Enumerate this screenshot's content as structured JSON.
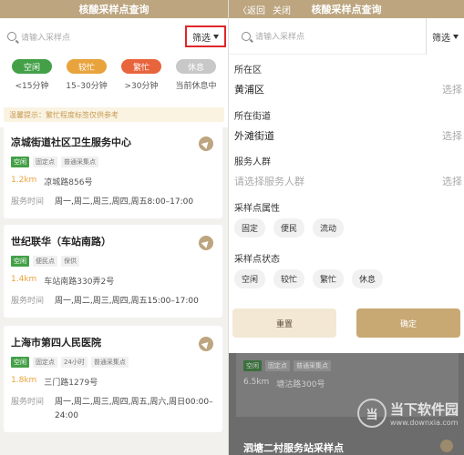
{
  "left": {
    "title": "核酸采样点查询",
    "search_placeholder": "请输入采样点",
    "filter_label": "筛选",
    "legend": [
      {
        "label": "空闲",
        "range": "<15分钟",
        "color": "#43a047"
      },
      {
        "label": "较忙",
        "range": "15–30分钟",
        "color": "#e8a33d"
      },
      {
        "label": "繁忙",
        "range": ">30分钟",
        "color": "#e8643d"
      },
      {
        "label": "休息",
        "range": "当前休息中",
        "color": "#c8c8c8"
      }
    ],
    "tip": "温馨提示：繁忙程度标签仅供参考",
    "cards": [
      {
        "name": "凉城街道社区卫生服务中心",
        "tags": [
          "空闲",
          "固定点",
          "普通采集点"
        ],
        "distance": "1.2km",
        "address": "凉城路856号",
        "hours_label": "服务时间",
        "hours": "周一,周二,周三,周四,周五8:00–17:00"
      },
      {
        "name": "世纪联华（车站南路）",
        "tags": [
          "空闲",
          "便民点",
          "保供"
        ],
        "distance": "1.4km",
        "address": "车站南路330弄2号",
        "hours_label": "服务时间",
        "hours": "周一,周二,周三,周四,周五15:00–17:00"
      },
      {
        "name": "上海市第四人民医院",
        "tags": [
          "空闲",
          "固定点",
          "24小时",
          "普通采集点"
        ],
        "distance": "1.8km",
        "address": "三门路1279号",
        "hours_label": "服务时间",
        "hours": "周一,周二,周三,周四,周五,周六,周日00:00–24:00"
      }
    ]
  },
  "right": {
    "back_label": "〈返回",
    "close_label": "关闭",
    "title": "核酸采样点查询",
    "search_placeholder": "请输入采样点",
    "filter_label": "筛选",
    "district_title": "所在区",
    "district_value": "黄浦区",
    "street_title": "所在街道",
    "street_value": "外滩街道",
    "crowd_title": "服务人群",
    "crowd_placeholder": "请选择服务人群",
    "pick_label": "选择",
    "attr_title": "采样点属性",
    "attr_chips": [
      "固定",
      "便民",
      "流动"
    ],
    "status_title": "采样点状态",
    "status_chips": [
      "空闲",
      "较忙",
      "繁忙",
      "休息"
    ],
    "reset_label": "重置",
    "confirm_label": "确定",
    "bg_card": {
      "tags": [
        "空闲",
        "固定点",
        "普通采集点"
      ],
      "distance": "6.5km",
      "address": "塘沽路300号",
      "name": "泗塘二村服务站采样点"
    },
    "watermark": {
      "logo": "当",
      "title": "当下软件园",
      "url": "www.downxia.com"
    }
  }
}
